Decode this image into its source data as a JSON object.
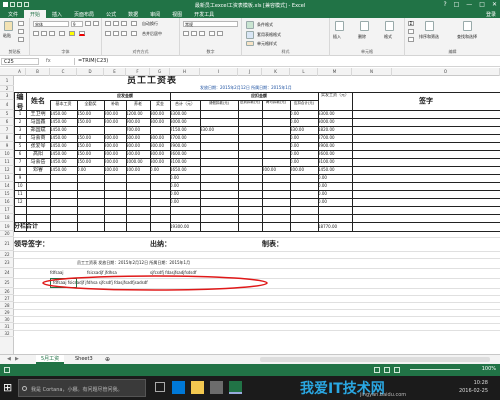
{
  "window": {
    "title": "最新员工excel工资表模板.xls [兼容模式] - Excel",
    "controls": [
      "?",
      "□",
      "—",
      "□",
      "✕"
    ]
  },
  "menu": {
    "tabs": [
      "文件",
      "开始",
      "插入",
      "页面布局",
      "公式",
      "数据",
      "审阅",
      "视图",
      "开发工具"
    ],
    "active": 1,
    "login": "登录"
  },
  "ribbon": {
    "clipboard": {
      "label": "剪贴板",
      "paste": "粘贴"
    },
    "font": {
      "label": "字体",
      "name": "宋体",
      "size": "9"
    },
    "alignment": {
      "label": "对齐方式",
      "wrap": "自动换行",
      "merge": "合并后居中"
    },
    "number": {
      "label": "数字",
      "format": "常规"
    },
    "styles": {
      "label": "样式",
      "items": [
        "条件格式",
        "套用表格格式",
        "单元格样式"
      ]
    },
    "cells": {
      "label": "单元格",
      "items": [
        "插入",
        "删除",
        "格式"
      ]
    },
    "editing": {
      "label": "编辑",
      "items": [
        "排序和筛选",
        "查找和选择"
      ]
    }
  },
  "formula_bar": {
    "name_box": "C25",
    "fx": "fx",
    "formula": "=TRIM(C23)"
  },
  "columns": [
    "A",
    "B",
    "C",
    "D",
    "E",
    "F",
    "G",
    "H",
    "I",
    "J",
    "K",
    "L",
    "M",
    "N",
    "O"
  ],
  "rows": [
    "1",
    "2",
    "3",
    "4",
    "5",
    "6",
    "7",
    "8",
    "9",
    "10",
    "11",
    "12",
    "13",
    "14",
    "15",
    "16",
    "17",
    "18",
    "19",
    "20",
    "21",
    "22",
    "23",
    "24",
    "25",
    "26",
    "27",
    "28",
    "29",
    "30",
    "31",
    "32"
  ],
  "sheet": {
    "title": "员工工资表",
    "meta": "发放日期：2015年2月12日  所属日期：2015年1月",
    "headers": {
      "no": "编号",
      "name": "姓名",
      "due": "应发金额",
      "deduct": "应扣金额",
      "net": "实发工资（元）",
      "sign": "签字",
      "sub": [
        "基本工资",
        "全勤奖",
        "补助",
        "养老",
        "奖金",
        "合计（元）",
        "请假扣款(元)",
        "迟到扣款(元)",
        "两可扣款(元)",
        "应扣合计(元)"
      ]
    },
    "employees": [
      {
        "no": "1",
        "name": "王卫明",
        "basic": "1450.00",
        "attend": "150.00",
        "allow": "200.00",
        "pension": "1200.00",
        "bonus": "300.00",
        "total": "3300.00",
        "leave": "",
        "late": "",
        "two": "",
        "deduct_total": "0.00",
        "net": "3300.00"
      },
      {
        "no": "2",
        "name": "马国鑫",
        "basic": "1450.00",
        "attend": "150.00",
        "allow": "200.00",
        "pension": "900.00",
        "bonus": "300.00",
        "total": "3000.00",
        "leave": "",
        "late": "",
        "two": "",
        "deduct_total": "0.00",
        "net": "3000.00"
      },
      {
        "no": "3",
        "name": "郑国斌",
        "basic": "1450.00",
        "attend": "",
        "allow": "",
        "pension": "700.00",
        "bonus": "",
        "total": "2150.00",
        "leave": "330.00",
        "late": "",
        "two": "",
        "deduct_total": "330.00",
        "net": "1820.00"
      },
      {
        "no": "4",
        "name": "马会商",
        "basic": "1450.00",
        "attend": "150.00",
        "allow": "200.00",
        "pension": "600.00",
        "bonus": "300.00",
        "total": "2700.00",
        "leave": "",
        "late": "",
        "two": "",
        "deduct_total": "0.00",
        "net": "2700.00"
      },
      {
        "no": "5",
        "name": "张爱琴",
        "basic": "1450.00",
        "attend": "150.00",
        "allow": "200.00",
        "pension": "800.00",
        "bonus": "300.00",
        "total": "2900.00",
        "leave": "",
        "late": "",
        "two": "",
        "deduct_total": "0.00",
        "net": "2900.00"
      },
      {
        "no": "6",
        "name": "高阳",
        "basic": "1450.00",
        "attend": "150.00",
        "allow": "200.00",
        "pension": "500.00",
        "bonus": "300.00",
        "total": "2600.00",
        "leave": "",
        "late": "",
        "two": "",
        "deduct_total": "0.00",
        "net": "2600.00"
      },
      {
        "no": "7",
        "name": "马会岳",
        "basic": "1450.00",
        "attend": "150.00",
        "allow": "200.00",
        "pension": "1000.00",
        "bonus": "300.00",
        "total": "3100.00",
        "leave": "",
        "late": "",
        "two": "",
        "deduct_total": "0.00",
        "net": "3100.00"
      },
      {
        "no": "8",
        "name": "邓睿",
        "basic": "1450.00",
        "attend": "0.00",
        "allow": "100.00",
        "pension": "100.00",
        "bonus": "0.00",
        "total": "1650.00",
        "leave": "",
        "late": "",
        "two": "200.00",
        "deduct_total": "200.00",
        "net": "1450.00"
      }
    ],
    "blank_rows": [
      {
        "no": "9",
        "total": "0.00",
        "net": "0.00"
      },
      {
        "no": "10",
        "total": "0.00",
        "net": "0.00"
      },
      {
        "no": "11",
        "total": "0.00",
        "net": "0.00"
      },
      {
        "no": "12",
        "total": "0.00",
        "net": "0.00"
      }
    ],
    "sum_label": "分栏合计",
    "sum_total": "19300.00",
    "sum_net": "18770.00",
    "sign_leader": "领导签字：",
    "sign_cashier": "出纳：",
    "sign_maker": "制表：",
    "row23": "员工工资表  发放日期：2015年2月12日  所属日期：2015年1月",
    "row24": [
      "fdfsaaj",
      "fsicsadjf jfdhsa",
      "sjfcsdfj fdasjfsadjfsdsdf"
    ],
    "row25": "fdfsaaj fsicsadjf jfdhsa sjfcsdfj fdasjfsadfjsadsdf"
  },
  "sheet_tabs": [
    "5月工资",
    "Sheet3"
  ],
  "status": {
    "zoom": "100%"
  },
  "taskbar": {
    "search": "我是 Cortana，小娜。有问题尽管问我。",
    "time": "10:28",
    "date": "2016-02-25",
    "watermark": "我爱IT技术网",
    "url": "jingyan.baidu.com"
  }
}
